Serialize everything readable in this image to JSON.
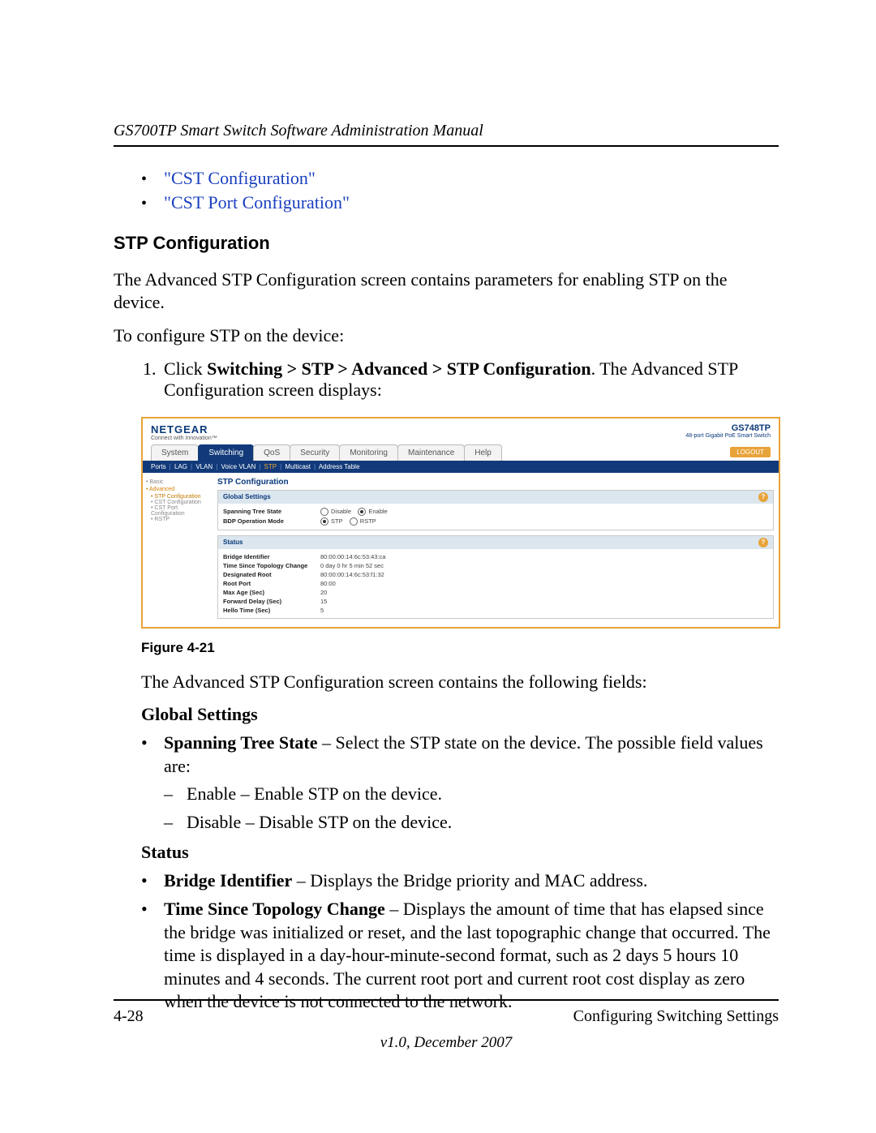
{
  "header": {
    "title": "GS700TP Smart Switch Software Administration Manual"
  },
  "topLinks": {
    "l1": "\"CST Configuration\"",
    "l2": "\"CST Port Configuration\""
  },
  "section": {
    "title": "STP Configuration"
  },
  "para1": "The Advanced STP Configuration screen contains parameters for enabling STP on the device.",
  "para2": "To configure STP on the device:",
  "step": {
    "prefix": "Click ",
    "path": "Switching > STP > Advanced > STP Configuration",
    "suffix": ". The Advanced STP Configuration screen displays:"
  },
  "shot": {
    "brand": "NETGEAR",
    "tagline": "Connect with Innovation™",
    "model": "GS748TP",
    "modelSub": "48-port Gigabit PoE Smart Switch",
    "tabs": [
      "System",
      "Switching",
      "QoS",
      "Security",
      "Monitoring",
      "Maintenance",
      "Help"
    ],
    "logout": "LOGOUT",
    "subnav": [
      "Ports",
      "LAG",
      "VLAN",
      "Voice VLAN",
      "STP",
      "Multicast",
      "Address Table"
    ],
    "side": {
      "basic": "Basic",
      "advanced": "Advanced",
      "i1": "STP Configuration",
      "i2": "CST Configuration",
      "i3": "CST Port Configuration",
      "i4": "RSTP"
    },
    "title": "STP Configuration",
    "box1": {
      "hd": "Global Settings",
      "r1k": "Spanning Tree State",
      "r1a": "Disable",
      "r1b": "Enable",
      "r2k": "BDP Operation Mode",
      "r2a": "STP",
      "r2b": "RSTP"
    },
    "box2": {
      "hd": "Status",
      "rows": [
        {
          "k": "Bridge Identifier",
          "v": "80:00:00:14:6c:53:43:ca"
        },
        {
          "k": "Time Since Topology Change",
          "v": "0 day 0 hr 5 min 52 sec"
        },
        {
          "k": "Designated Root",
          "v": "80:00:00:14:6c:53:f1:32"
        },
        {
          "k": "Root Port",
          "v": "80:00"
        },
        {
          "k": "Max Age (Sec)",
          "v": "20"
        },
        {
          "k": "Forward Delay (Sec)",
          "v": "15"
        },
        {
          "k": "Hello Time (Sec)",
          "v": "5"
        }
      ]
    }
  },
  "figcap": "Figure 4-21",
  "para3": "The Advanced STP Configuration screen contains the following fields:",
  "gs": {
    "hd": "Global Settings",
    "b1a": "Spanning Tree State",
    "b1b": " – Select the STP state on the device. The possible field values are:",
    "s1": "Enable – Enable STP on the device.",
    "s2": "Disable – Disable STP on the device."
  },
  "st": {
    "hd": "Status",
    "b1a": "Bridge Identifier",
    "b1b": " – Displays the Bridge priority and MAC address.",
    "b2a": "Time Since Topology Change",
    "b2b": " – Displays the amount of time that has elapsed since the bridge was initialized or reset, and the last topographic change that occurred. The time is displayed in a day-hour-minute-second format, such as 2 days 5 hours 10 minutes and 4 seconds. The current root port and current root cost display as zero when the device is not connected to the network."
  },
  "footer": {
    "left": "4-28",
    "right": "Configuring Switching Settings",
    "ver": "v1.0, December 2007"
  }
}
